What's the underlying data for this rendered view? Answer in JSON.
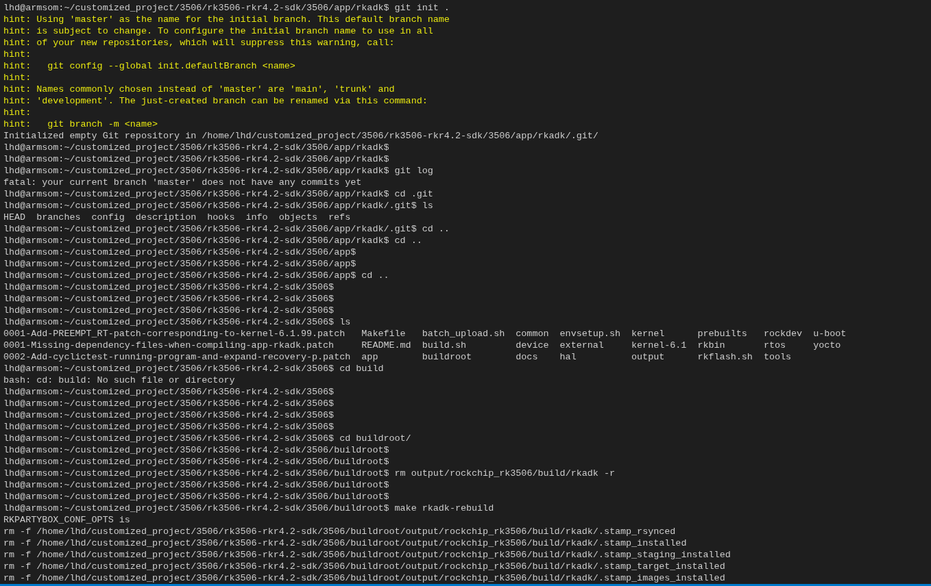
{
  "terminal": {
    "lines": [
      {
        "kind": "output",
        "text": "lhd@armsom:~/customized_project/3506/rk3506-rkr4.2-sdk/3506/app/rkadk$ git init ."
      },
      {
        "kind": "hint",
        "text": "hint: Using 'master' as the name for the initial branch. This default branch name"
      },
      {
        "kind": "hint",
        "text": "hint: is subject to change. To configure the initial branch name to use in all"
      },
      {
        "kind": "hint",
        "text": "hint: of your new repositories, which will suppress this warning, call:"
      },
      {
        "kind": "hint",
        "text": "hint:"
      },
      {
        "kind": "hint",
        "text": "hint:   git config --global init.defaultBranch <name>"
      },
      {
        "kind": "hint",
        "text": "hint:"
      },
      {
        "kind": "hint",
        "text": "hint: Names commonly chosen instead of 'master' are 'main', 'trunk' and"
      },
      {
        "kind": "hint",
        "text": "hint: 'development'. The just-created branch can be renamed via this command:"
      },
      {
        "kind": "hint",
        "text": "hint:"
      },
      {
        "kind": "hint",
        "text": "hint:   git branch -m <name>"
      },
      {
        "kind": "output",
        "text": "Initialized empty Git repository in /home/lhd/customized_project/3506/rk3506-rkr4.2-sdk/3506/app/rkadk/.git/"
      },
      {
        "kind": "output",
        "text": "lhd@armsom:~/customized_project/3506/rk3506-rkr4.2-sdk/3506/app/rkadk$"
      },
      {
        "kind": "output",
        "text": "lhd@armsom:~/customized_project/3506/rk3506-rkr4.2-sdk/3506/app/rkadk$"
      },
      {
        "kind": "output",
        "text": "lhd@armsom:~/customized_project/3506/rk3506-rkr4.2-sdk/3506/app/rkadk$ git log"
      },
      {
        "kind": "output",
        "text": "fatal: your current branch 'master' does not have any commits yet"
      },
      {
        "kind": "output",
        "text": "lhd@armsom:~/customized_project/3506/rk3506-rkr4.2-sdk/3506/app/rkadk$ cd .git"
      },
      {
        "kind": "output",
        "text": "lhd@armsom:~/customized_project/3506/rk3506-rkr4.2-sdk/3506/app/rkadk/.git$ ls"
      },
      {
        "kind": "listing",
        "rows": [
          [
            "HEAD",
            "branches",
            "config",
            "description",
            "hooks",
            "info",
            "objects",
            "refs"
          ]
        ]
      },
      {
        "kind": "output",
        "text": "lhd@armsom:~/customized_project/3506/rk3506-rkr4.2-sdk/3506/app/rkadk/.git$ cd .."
      },
      {
        "kind": "output",
        "text": "lhd@armsom:~/customized_project/3506/rk3506-rkr4.2-sdk/3506/app/rkadk$ cd .."
      },
      {
        "kind": "output",
        "text": "lhd@armsom:~/customized_project/3506/rk3506-rkr4.2-sdk/3506/app$"
      },
      {
        "kind": "output",
        "text": "lhd@armsom:~/customized_project/3506/rk3506-rkr4.2-sdk/3506/app$"
      },
      {
        "kind": "output",
        "text": "lhd@armsom:~/customized_project/3506/rk3506-rkr4.2-sdk/3506/app$ cd .."
      },
      {
        "kind": "output",
        "text": "lhd@armsom:~/customized_project/3506/rk3506-rkr4.2-sdk/3506$"
      },
      {
        "kind": "output",
        "text": "lhd@armsom:~/customized_project/3506/rk3506-rkr4.2-sdk/3506$"
      },
      {
        "kind": "output",
        "text": "lhd@armsom:~/customized_project/3506/rk3506-rkr4.2-sdk/3506$"
      },
      {
        "kind": "output",
        "text": "lhd@armsom:~/customized_project/3506/rk3506-rkr4.2-sdk/3506$ ls"
      },
      {
        "kind": "listing",
        "rows": [
          [
            "0001-Add-PREEMPT_RT-patch-corresponding-to-kernel-6.1.99.patch",
            "Makefile",
            "batch_upload.sh",
            "common",
            "envsetup.sh",
            "kernel",
            "prebuilts",
            "rockdev",
            "u-boot"
          ],
          [
            "0001-Missing-dependency-files-when-compiling-app-rkadk.patch",
            "README.md",
            "build.sh",
            "device",
            "external",
            "kernel-6.1",
            "rkbin",
            "rtos",
            "yocto"
          ],
          [
            "0002-Add-cyclictest-running-program-and-expand-recovery-p.patch",
            "app",
            "buildroot",
            "docs",
            "hal",
            "output",
            "rkflash.sh",
            "tools"
          ]
        ]
      },
      {
        "kind": "output",
        "text": "lhd@armsom:~/customized_project/3506/rk3506-rkr4.2-sdk/3506$ cd build"
      },
      {
        "kind": "output",
        "text": "bash: cd: build: No such file or directory"
      },
      {
        "kind": "output",
        "text": "lhd@armsom:~/customized_project/3506/rk3506-rkr4.2-sdk/3506$"
      },
      {
        "kind": "output",
        "text": "lhd@armsom:~/customized_project/3506/rk3506-rkr4.2-sdk/3506$"
      },
      {
        "kind": "output",
        "text": "lhd@armsom:~/customized_project/3506/rk3506-rkr4.2-sdk/3506$"
      },
      {
        "kind": "output",
        "text": "lhd@armsom:~/customized_project/3506/rk3506-rkr4.2-sdk/3506$"
      },
      {
        "kind": "output",
        "text": "lhd@armsom:~/customized_project/3506/rk3506-rkr4.2-sdk/3506$ cd buildroot/"
      },
      {
        "kind": "output",
        "text": "lhd@armsom:~/customized_project/3506/rk3506-rkr4.2-sdk/3506/buildroot$"
      },
      {
        "kind": "output",
        "text": "lhd@armsom:~/customized_project/3506/rk3506-rkr4.2-sdk/3506/buildroot$"
      },
      {
        "kind": "output",
        "text": "lhd@armsom:~/customized_project/3506/rk3506-rkr4.2-sdk/3506/buildroot$ rm output/rockchip_rk3506/build/rkadk -r"
      },
      {
        "kind": "output",
        "text": "lhd@armsom:~/customized_project/3506/rk3506-rkr4.2-sdk/3506/buildroot$"
      },
      {
        "kind": "output",
        "text": "lhd@armsom:~/customized_project/3506/rk3506-rkr4.2-sdk/3506/buildroot$"
      },
      {
        "kind": "output",
        "text": "lhd@armsom:~/customized_project/3506/rk3506-rkr4.2-sdk/3506/buildroot$ make rkadk-rebuild"
      },
      {
        "kind": "output",
        "text": "RKPARTYBOX_CONF_OPTS is"
      },
      {
        "kind": "output",
        "text": "rm -f /home/lhd/customized_project/3506/rk3506-rkr4.2-sdk/3506/buildroot/output/rockchip_rk3506/build/rkadk/.stamp_rsynced"
      },
      {
        "kind": "output",
        "text": "rm -f /home/lhd/customized_project/3506/rk3506-rkr4.2-sdk/3506/buildroot/output/rockchip_rk3506/build/rkadk/.stamp_installed"
      },
      {
        "kind": "output",
        "text": "rm -f /home/lhd/customized_project/3506/rk3506-rkr4.2-sdk/3506/buildroot/output/rockchip_rk3506/build/rkadk/.stamp_staging_installed"
      },
      {
        "kind": "output",
        "text": "rm -f /home/lhd/customized_project/3506/rk3506-rkr4.2-sdk/3506/buildroot/output/rockchip_rk3506/build/rkadk/.stamp_target_installed"
      },
      {
        "kind": "output",
        "text": "rm -f /home/lhd/customized_project/3506/rk3506-rkr4.2-sdk/3506/buildroot/output/rockchip_rk3506/build/rkadk/.stamp_images_installed"
      }
    ]
  }
}
